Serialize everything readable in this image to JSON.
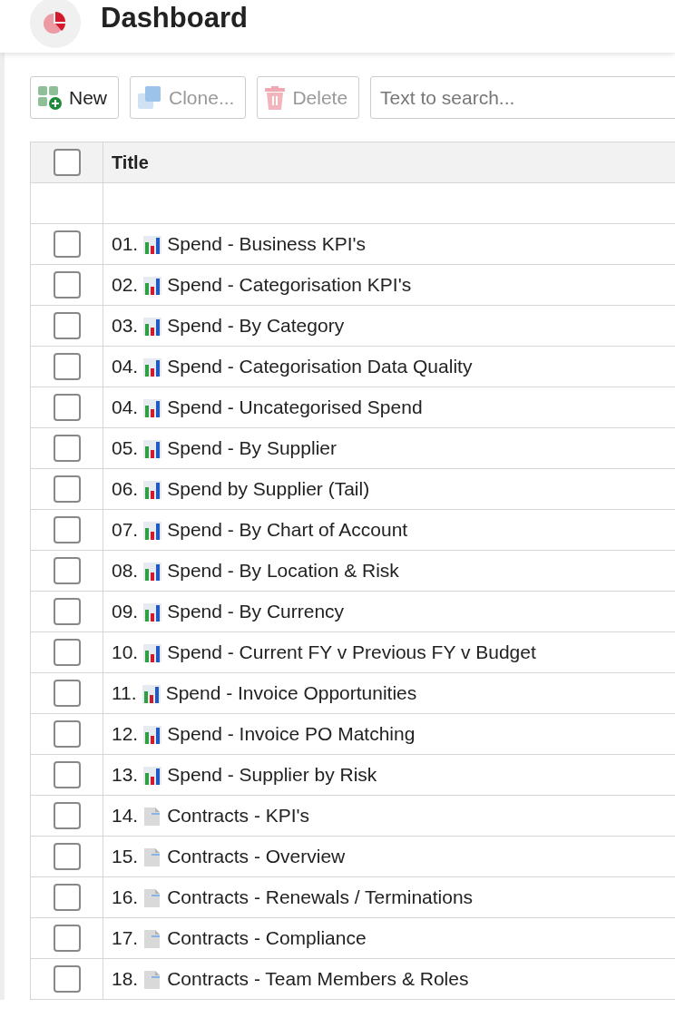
{
  "header": {
    "title": "Dashboard"
  },
  "toolbar": {
    "buttons": [
      {
        "kind": "new",
        "label": "New",
        "disabled": false
      },
      {
        "kind": "clone",
        "label": "Clone...",
        "disabled": true
      },
      {
        "kind": "delete",
        "label": "Delete",
        "disabled": true
      }
    ],
    "search": {
      "placeholder": "Text to search..."
    }
  },
  "table": {
    "columns": [
      {
        "label": "Title"
      }
    ],
    "header_checked": false,
    "rows": [
      {
        "number": "01.",
        "kind": "chart",
        "title": "Spend - Business KPI's",
        "checked": false
      },
      {
        "number": "02.",
        "kind": "chart",
        "title": "Spend - Categorisation KPI's",
        "checked": false
      },
      {
        "number": "03.",
        "kind": "chart",
        "title": "Spend - By Category",
        "checked": false
      },
      {
        "number": "04.",
        "kind": "chart",
        "title": "Spend - Categorisation Data Quality",
        "checked": false
      },
      {
        "number": "04.",
        "kind": "chart",
        "title": "Spend - Uncategorised Spend",
        "checked": false
      },
      {
        "number": "05.",
        "kind": "chart",
        "title": "Spend - By Supplier",
        "checked": false
      },
      {
        "number": "06.",
        "kind": "chart",
        "title": "Spend by Supplier (Tail)",
        "checked": false
      },
      {
        "number": "07.",
        "kind": "chart",
        "title": "Spend - By Chart of Account",
        "checked": false
      },
      {
        "number": "08.",
        "kind": "chart",
        "title": "Spend - By Location & Risk",
        "checked": false
      },
      {
        "number": "09.",
        "kind": "chart",
        "title": "Spend - By Currency",
        "checked": false
      },
      {
        "number": "10.",
        "kind": "chart",
        "title": "Spend - Current FY v Previous FY v Budget",
        "checked": false
      },
      {
        "number": "11.",
        "kind": "chart",
        "title": "Spend - Invoice Opportunities",
        "checked": false
      },
      {
        "number": "12.",
        "kind": "chart",
        "title": "Spend - Invoice PO Matching",
        "checked": false
      },
      {
        "number": "13.",
        "kind": "chart",
        "title": "Spend - Supplier by Risk",
        "checked": false
      },
      {
        "number": "14.",
        "kind": "document",
        "title": "Contracts - KPI's",
        "checked": false
      },
      {
        "number": "15.",
        "kind": "document",
        "title": "Contracts - Overview",
        "checked": false
      },
      {
        "number": "16.",
        "kind": "document",
        "title": "Contracts - Renewals / Terminations",
        "checked": false
      },
      {
        "number": "17.",
        "kind": "document",
        "title": "Contracts - Compliance",
        "checked": false
      },
      {
        "number": "18.",
        "kind": "document",
        "title": "Contracts - Team Members & Roles",
        "checked": false
      }
    ]
  }
}
